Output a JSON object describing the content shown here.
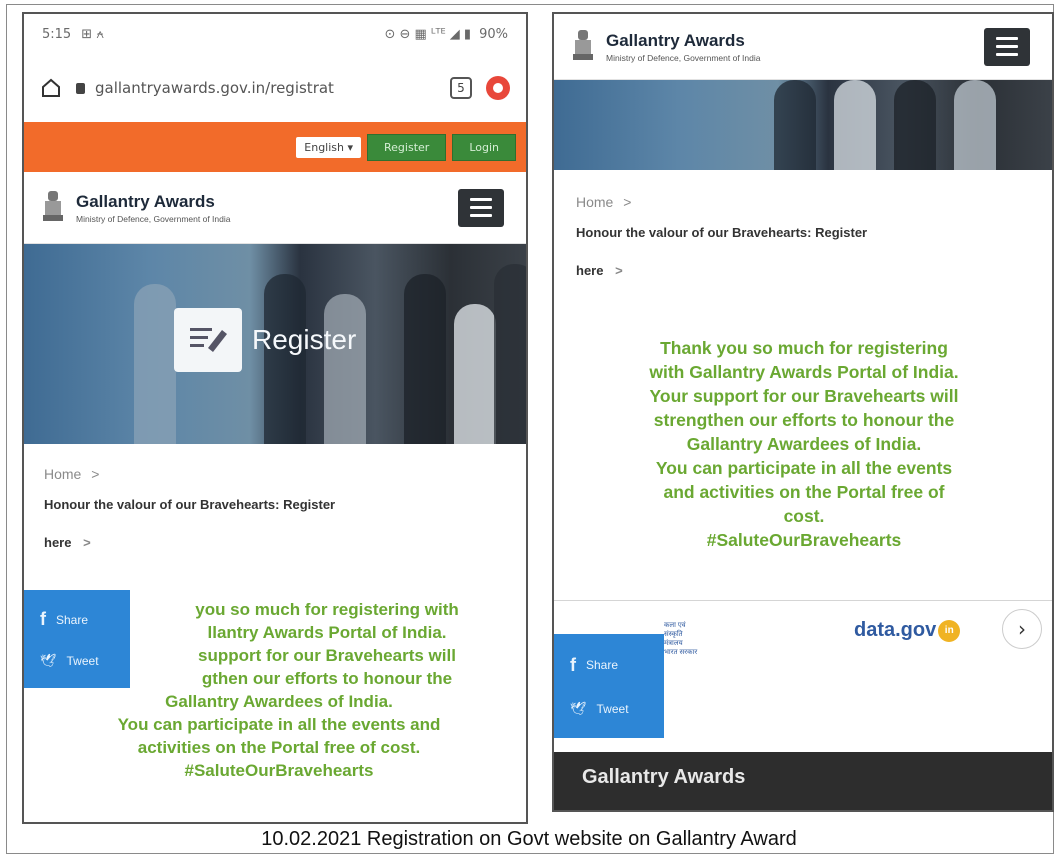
{
  "left_phone": {
    "status": {
      "time": "5:15",
      "left_icons": "⊞ ⍲",
      "right_icons": "⊙ ⊖ ▦ ᴸᵀᴱ ◢ ▮",
      "battery": "90%"
    },
    "url": {
      "text": "gallantryawards.gov.in/registrat",
      "tab_count": "5"
    },
    "top_strip": {
      "language": "English ▾",
      "register": "Register",
      "login": "Login"
    },
    "header": {
      "title": "Gallantry Awards",
      "subtitle": "Ministry of Defence, Government of India"
    },
    "banner": {
      "label": "Register"
    },
    "breadcrumb": {
      "home": "Home",
      "separator": ">",
      "title": "Honour the valour of our Bravehearts: Register",
      "title_line2": "here",
      "title_sep2": ">"
    },
    "thanks": {
      "lines": [
        "you so much for registering with",
        "llantry Awards Portal of India.",
        "support for our Bravehearts will",
        "gthen our efforts to honour the",
        "Gallantry Awardees of India.",
        "You can participate in all the events and",
        "activities on the Portal free of cost.",
        "#SaluteOurBravehearts"
      ]
    },
    "share": {
      "facebook": "Share",
      "twitter": "Tweet"
    }
  },
  "right_phone": {
    "header": {
      "title": "Gallantry Awards",
      "subtitle": "Ministry of Defence, Government of India"
    },
    "breadcrumb": {
      "home": "Home",
      "separator": ">",
      "title": "Honour the valour of our Bravehearts: Register",
      "title_line2": "here",
      "title_sep2": ">"
    },
    "thanks": {
      "lines": [
        "Thank you so much for registering",
        "with Gallantry Awards Portal of India.",
        "Your support for our Bravehearts will",
        "strengthen our efforts to honour the",
        "Gallantry Awardees of India.",
        "You can participate in all the events",
        "and activities on the Portal free of",
        "cost.",
        "#SaluteOurBravehearts"
      ]
    },
    "share": {
      "facebook": "Share",
      "twitter": "Tweet"
    },
    "logos": {
      "small_logo_text": "कला एवं\nसंस्कृति\nमंत्रालय\nभारत सरकार",
      "datagov": "data.gov",
      "datagov_badge": "in",
      "next": "›"
    },
    "footer": {
      "title": "Gallantry Awards"
    }
  },
  "caption": "10.02.2021 Registration on Govt website on Gallantry Award",
  "colors": {
    "orange": "#f26b2a",
    "green_text": "#6aa832",
    "share_blue": "#2d86d6",
    "footer_dark": "#2d2d2d"
  }
}
